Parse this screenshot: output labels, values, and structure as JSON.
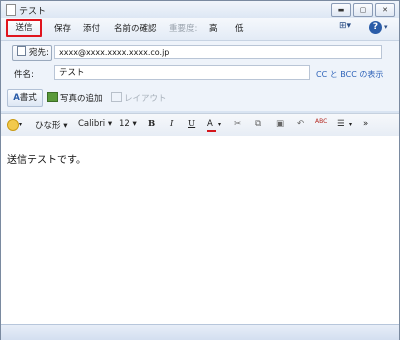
{
  "window": {
    "title": "テスト"
  },
  "toolbar": {
    "send": "送信",
    "save": "保存",
    "attach": "添付",
    "check_names": "名前の確認",
    "priority": "重要度:",
    "high": "高",
    "low": "低"
  },
  "header": {
    "to_label": "宛先:",
    "to_value": "xxxx@xxxx.xxxx.xxxx.co.jp",
    "subject_label": "件名:",
    "subject_value": "テスト",
    "cc_bcc_link": "CC と BCC の表示",
    "format_button": "書式",
    "add_photo": "写真の追加",
    "layout": "レイアウト"
  },
  "format_bar": {
    "style": "ひな形",
    "font": "Calibri",
    "size": "12",
    "bold": "B",
    "italic": "I",
    "underline": "U",
    "font_color": "A",
    "spell": "ABC",
    "list": "☰",
    "more": "»"
  },
  "body": {
    "text": "送信テストです。"
  },
  "colors": {
    "highlight": "#e0141d",
    "accent": "#2d62b8"
  }
}
